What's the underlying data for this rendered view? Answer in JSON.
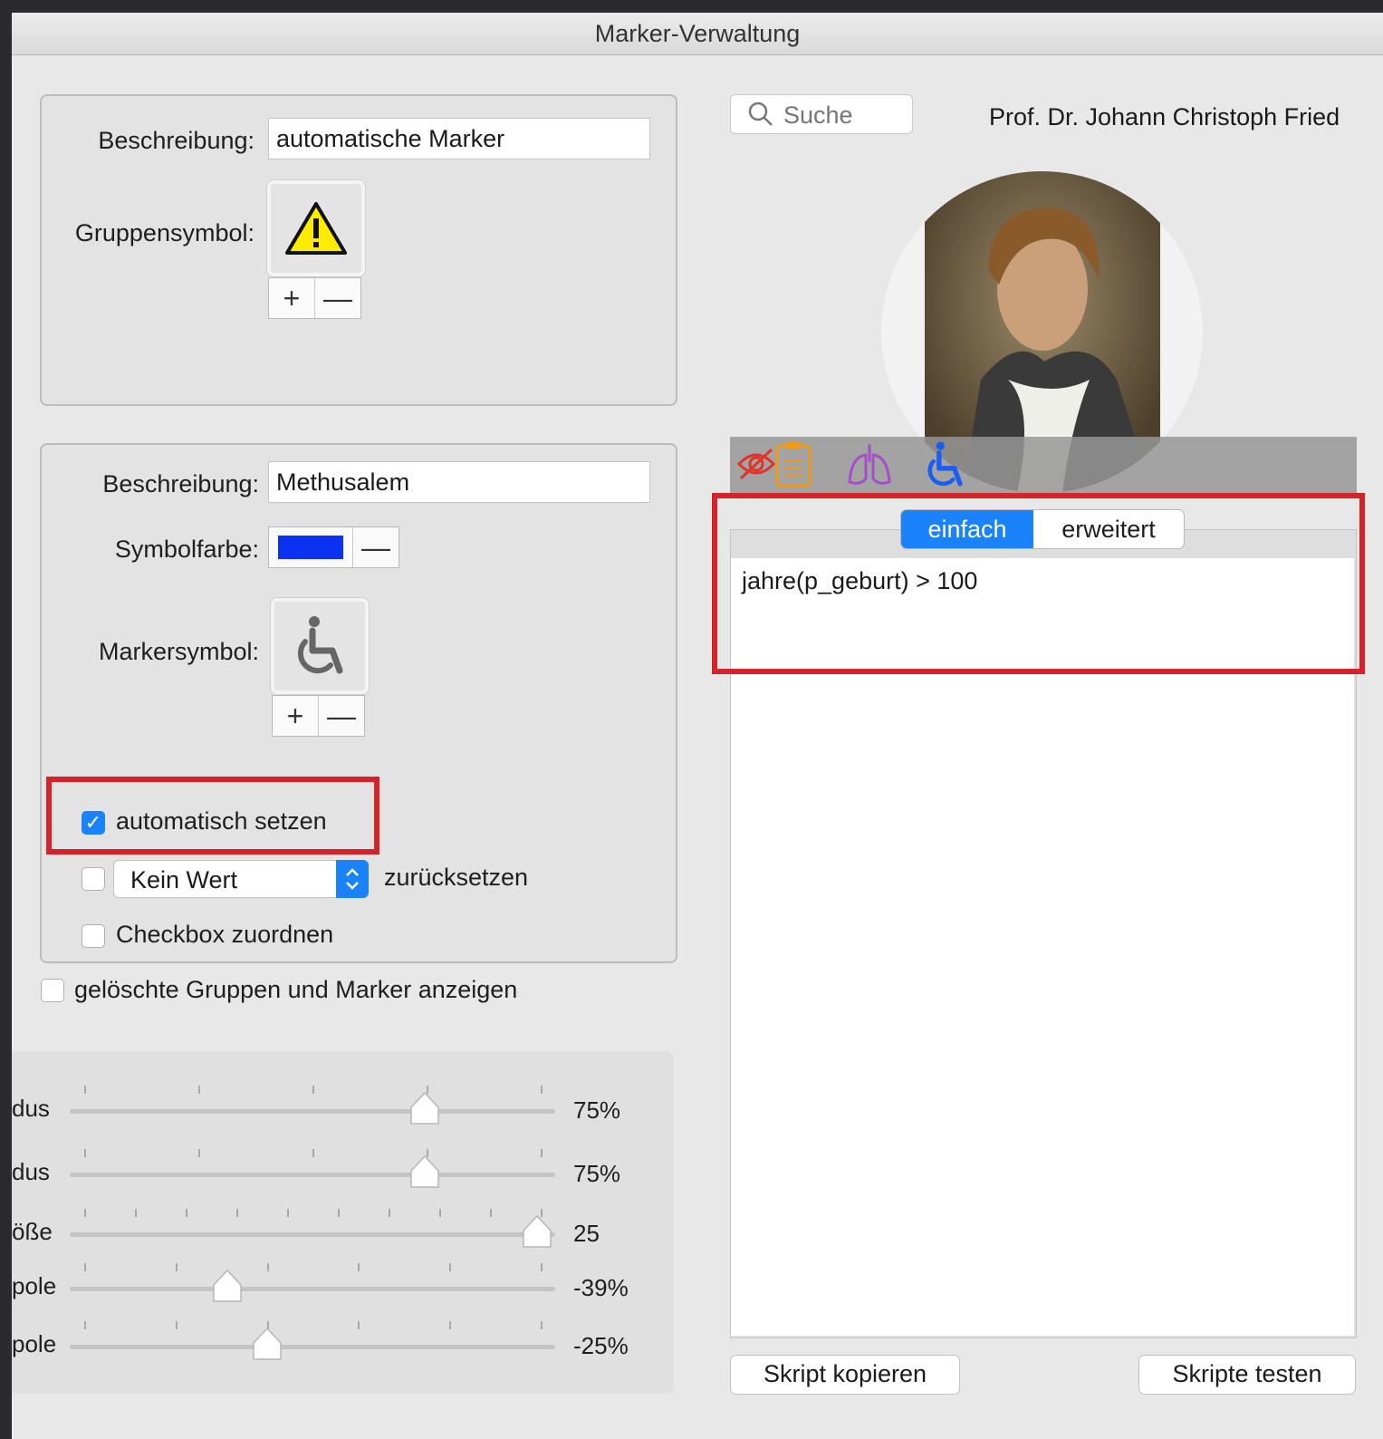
{
  "window": {
    "title": "Marker-Verwaltung"
  },
  "group": {
    "description_label": "Beschreibung:",
    "description_value": "automatische Marker",
    "symbol_label": "Gruppensymbol:",
    "symbol_icon": "warning-icon",
    "add_label": "+",
    "remove_label": "—"
  },
  "marker": {
    "description_label": "Beschreibung:",
    "description_value": "Methusalem",
    "color_label": "Symbolfarbe:",
    "color_value": "#0a32f0",
    "color_remove_label": "—",
    "symbol_label": "Markersymbol:",
    "symbol_icon": "wheelchair-icon",
    "add_label": "+",
    "remove_label": "—",
    "auto_set_label": "automatisch setzen",
    "auto_set_checked": true,
    "reset_select_value": "Kein Wert",
    "reset_label": "zurücksetzen",
    "reset_checked": false,
    "assign_checkbox_label": "Checkbox zuordnen",
    "assign_checked": false
  },
  "show_deleted": {
    "label": "gelöschte Gruppen und Marker anzeigen",
    "checked": false
  },
  "sliders": [
    {
      "label": "dus",
      "value_text": "75%",
      "value": 0.75
    },
    {
      "label": "dus",
      "value_text": "75%",
      "value": 0.75
    },
    {
      "label": "öße",
      "value_text": "25",
      "value": 1.0
    },
    {
      "label": "pole",
      "value_text": "-39%",
      "value": 0.31
    },
    {
      "label": "pole",
      "value_text": "-25%",
      "value": 0.4
    }
  ],
  "search": {
    "placeholder": "Suche"
  },
  "patient": {
    "name": "Prof. Dr. Johann Christoph Fried"
  },
  "marker_strip_icons": [
    "eye-speech-icon",
    "clipboard-icon",
    "lungs-icon",
    "wheelchair-icon"
  ],
  "script_tabs": [
    {
      "label": "einfach",
      "active": true
    },
    {
      "label": "erweitert",
      "active": false
    }
  ],
  "script": {
    "text": "jahre(p_geburt) > 100"
  },
  "buttons": {
    "copy_script": "Skript kopieren",
    "test_scripts": "Skripte testen"
  },
  "colors": {
    "accent": "#1a82fb",
    "highlight": "#d4232b"
  }
}
